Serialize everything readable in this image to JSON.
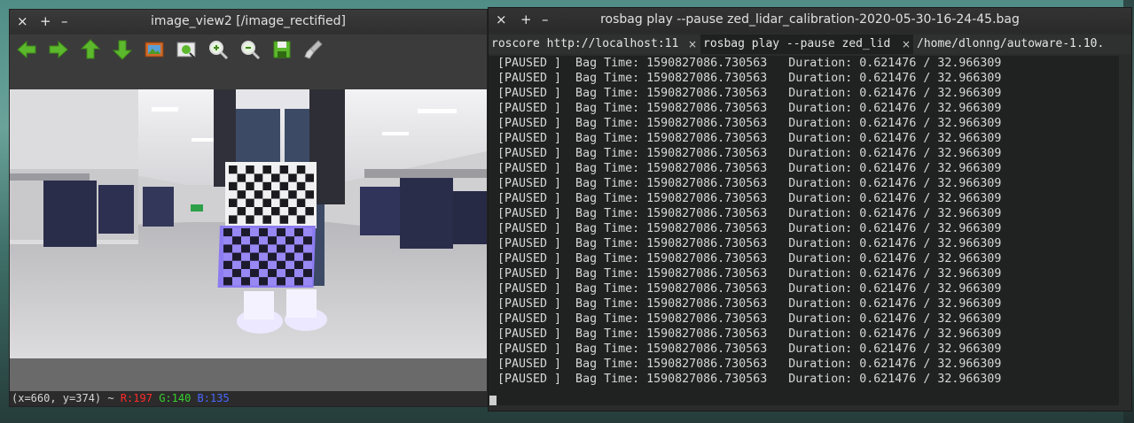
{
  "viewer": {
    "title": "image_view2 [/image_rectified]",
    "controls": {
      "close": "×",
      "add": "+",
      "minimize": "–"
    },
    "toolbar_icons": [
      "left-arrow-icon",
      "right-arrow-icon",
      "up-arrow-icon",
      "down-arrow-icon",
      "image-icon",
      "fit-image-icon",
      "zoom-in-icon",
      "zoom-out-icon",
      "save-icon",
      "clear-brush-icon"
    ],
    "status": {
      "coords": "(x=660, y=374) ~ ",
      "r": "R:197",
      "g": "G:140",
      "b": "B:135"
    }
  },
  "terminal": {
    "title": "rosbag play --pause zed_lidar_calibration-2020-05-30-16-24-45.bag",
    "controls": {
      "close": "×",
      "add": "+",
      "minimize": "–"
    },
    "tabs": [
      {
        "label": "roscore http://localhost:11",
        "active": false
      },
      {
        "label": "rosbag play --pause zed_lid",
        "active": true
      },
      {
        "label": "/home/dlonng/autoware-1.10.",
        "active": false
      }
    ],
    "tab_close": "×",
    "lines": [
      "[PAUSED ]  Bag Time: 1590827086.730563   Duration: 0.621476 / 32.966309",
      "[PAUSED ]  Bag Time: 1590827086.730563   Duration: 0.621476 / 32.966309",
      "[PAUSED ]  Bag Time: 1590827086.730563   Duration: 0.621476 / 32.966309",
      "[PAUSED ]  Bag Time: 1590827086.730563   Duration: 0.621476 / 32.966309",
      "[PAUSED ]  Bag Time: 1590827086.730563   Duration: 0.621476 / 32.966309",
      "[PAUSED ]  Bag Time: 1590827086.730563   Duration: 0.621476 / 32.966309",
      "[PAUSED ]  Bag Time: 1590827086.730563   Duration: 0.621476 / 32.966309",
      "[PAUSED ]  Bag Time: 1590827086.730563   Duration: 0.621476 / 32.966309",
      "[PAUSED ]  Bag Time: 1590827086.730563   Duration: 0.621476 / 32.966309",
      "[PAUSED ]  Bag Time: 1590827086.730563   Duration: 0.621476 / 32.966309",
      "[PAUSED ]  Bag Time: 1590827086.730563   Duration: 0.621476 / 32.966309",
      "[PAUSED ]  Bag Time: 1590827086.730563   Duration: 0.621476 / 32.966309",
      "[PAUSED ]  Bag Time: 1590827086.730563   Duration: 0.621476 / 32.966309",
      "[PAUSED ]  Bag Time: 1590827086.730563   Duration: 0.621476 / 32.966309",
      "[PAUSED ]  Bag Time: 1590827086.730563   Duration: 0.621476 / 32.966309",
      "[PAUSED ]  Bag Time: 1590827086.730563   Duration: 0.621476 / 32.966309",
      "[PAUSED ]  Bag Time: 1590827086.730563   Duration: 0.621476 / 32.966309",
      "[PAUSED ]  Bag Time: 1590827086.730563   Duration: 0.621476 / 32.966309",
      "[PAUSED ]  Bag Time: 1590827086.730563   Duration: 0.621476 / 32.966309",
      "[PAUSED ]  Bag Time: 1590827086.730563   Duration: 0.621476 / 32.966309",
      "[PAUSED ]  Bag Time: 1590827086.730563   Duration: 0.621476 / 32.966309",
      "[PAUSED ]  Bag Time: 1590827086.730563   Duration: 0.621476 / 32.966309"
    ]
  }
}
